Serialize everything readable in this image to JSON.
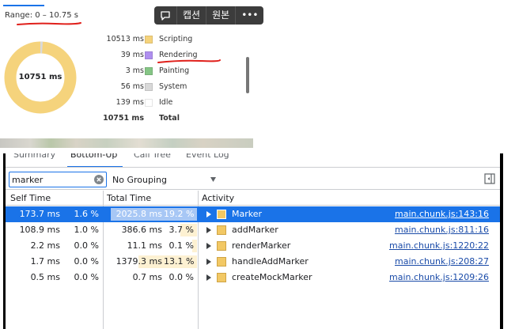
{
  "summary": {
    "range_label": "Range: 0 – 10.75 s",
    "donut_center": "10751 ms",
    "legend": [
      {
        "value": "10513 ms",
        "name": "Scripting",
        "color": "#f5d37c"
      },
      {
        "value": "39 ms",
        "name": "Rendering",
        "color": "#af8fef"
      },
      {
        "value": "3 ms",
        "name": "Painting",
        "color": "#85c585"
      },
      {
        "value": "56 ms",
        "name": "System",
        "color": "#d9d9d9"
      },
      {
        "value": "139 ms",
        "name": "Idle",
        "color": "#ffffff"
      }
    ],
    "total": {
      "value": "10751 ms",
      "name": "Total"
    },
    "donut_fractions": {
      "scripting": 0.978,
      "rendering": 0.004,
      "painting": 0.0003,
      "system": 0.005,
      "idle": 0.013
    }
  },
  "overlay": {
    "caption_label": "캡션",
    "original_label": "원본",
    "more_label": "•••"
  },
  "tabs": [
    {
      "label": "Summary"
    },
    {
      "label": "Bottom-Up"
    },
    {
      "label": "Call Tree"
    },
    {
      "label": "Event Log"
    }
  ],
  "toolbar": {
    "filter_value": "marker",
    "grouping_label": "No Grouping"
  },
  "headers": {
    "self_time": "Self Time",
    "total_time": "Total Time",
    "activity": "Activity"
  },
  "rows": [
    {
      "self_ms": "173.7 ms",
      "self_pct": "1.6 %",
      "self_frac": 0.016,
      "total_ms": "2025.8 ms",
      "total_pct": "19.2 %",
      "total_frac": 0.192,
      "name": "Marker",
      "link": "main.chunk.js:143:16",
      "selected": true
    },
    {
      "self_ms": "108.9 ms",
      "self_pct": "1.0 %",
      "self_frac": 0.01,
      "total_ms": "386.6 ms",
      "total_pct": "3.7 %",
      "total_frac": 0.037,
      "name": "addMarker",
      "link": "main.chunk.js:811:16",
      "selected": false
    },
    {
      "self_ms": "2.2 ms",
      "self_pct": "0.0 %",
      "self_frac": 0.0,
      "total_ms": "11.1 ms",
      "total_pct": "0.1 %",
      "total_frac": 0.001,
      "name": "renderMarker",
      "link": "main.chunk.js:1220:22",
      "selected": false
    },
    {
      "self_ms": "1.7 ms",
      "self_pct": "0.0 %",
      "self_frac": 0.0,
      "total_ms": "1379.3 ms",
      "total_pct": "13.1 %",
      "total_frac": 0.131,
      "name": "handleAddMarker",
      "link": "main.chunk.js:208:27",
      "selected": false
    },
    {
      "self_ms": "0.5 ms",
      "self_pct": "0.0 %",
      "self_frac": 0.0,
      "total_ms": "0.7 ms",
      "total_pct": "0.0 %",
      "total_frac": 0.0,
      "name": "createMockMarker",
      "link": "main.chunk.js:1209:26",
      "selected": false
    }
  ]
}
